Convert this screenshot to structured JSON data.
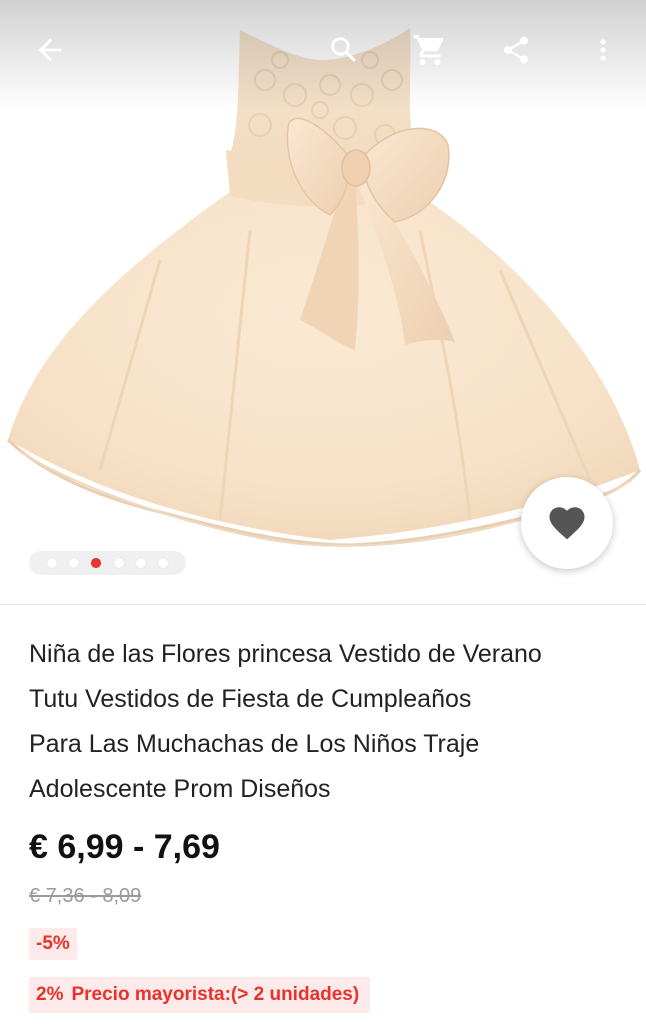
{
  "colors": {
    "accent_red": "#e8322a",
    "discount_bg": "#fdeaea",
    "dress": "#f8e4cc",
    "text_dark": "#222222",
    "text_muted": "#9a9a9a"
  },
  "topbar": {
    "icons": [
      "back-arrow-icon",
      "search-icon",
      "cart-icon",
      "share-icon",
      "more-vert-icon"
    ]
  },
  "gallery": {
    "total_images": 6,
    "active_index": 2,
    "wishlist_icon": "heart-icon"
  },
  "product": {
    "title_lines": [
      "Niña de las Flores princesa Vestido de Verano",
      "Tutu Vestidos de Fiesta de Cumpleaños",
      "Para Las Muchachas de Los Niños Traje",
      "Adolescente Prom Diseños"
    ],
    "price": "€ 6,99 - 7,69",
    "original_price": "€ 7,36 - 8,09",
    "discount": "-5%",
    "wholesale_percent": "2%",
    "wholesale_text": "Precio mayorista:(> 2 unidades)"
  }
}
